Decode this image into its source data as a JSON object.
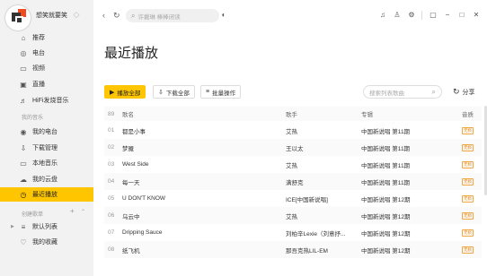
{
  "app": {
    "username": "想笑就要笑"
  },
  "sidebar": {
    "top_items": [
      {
        "label": "推荐",
        "icon": "home-icon"
      },
      {
        "label": "电台",
        "icon": "radio-icon"
      },
      {
        "label": "视频",
        "icon": "video-icon"
      },
      {
        "label": "直播",
        "icon": "live-icon"
      },
      {
        "label": "HiFi发烧音乐",
        "icon": "hifi-icon"
      }
    ],
    "my_music_label": "我的音乐",
    "my_music_items": [
      {
        "label": "我的电台",
        "icon": "my-radio-icon"
      },
      {
        "label": "下载管理",
        "icon": "download-icon"
      },
      {
        "label": "本地音乐",
        "icon": "local-music-icon"
      },
      {
        "label": "我的云盘",
        "icon": "cloud-icon"
      },
      {
        "label": "最近播放",
        "icon": "clock-icon",
        "active": true
      }
    ],
    "created_label": "创建歌单",
    "created_tools": "+",
    "created_items": [
      {
        "label": "默认列表",
        "icon": "playlist-icon"
      },
      {
        "label": "我的收藏",
        "icon": "heart-icon"
      }
    ]
  },
  "topbar": {
    "search_placeholder": "许戴琳 棒棒闭读"
  },
  "page": {
    "title": "最近播放"
  },
  "toolbar": {
    "play_all": "播放全部",
    "download_all": "下载全部",
    "batch": "批量操作",
    "search_placeholder": "搜索列表歌曲",
    "share": "分享"
  },
  "table": {
    "count": "89",
    "headers": {
      "name": "歌名",
      "artist": "歌手",
      "album": "专辑",
      "quality": "音质"
    },
    "rows": [
      {
        "idx": "01",
        "name": "都是小事",
        "artist": "艾热",
        "album": "中国新说唱 第11期",
        "quality": "无损"
      },
      {
        "idx": "02",
        "name": "梦魇",
        "artist": "王以太",
        "album": "中国新说唱 第11期",
        "quality": "无损"
      },
      {
        "idx": "03",
        "name": "West Side",
        "artist": "艾热",
        "album": "中国新说唱 第11期",
        "quality": "无损"
      },
      {
        "idx": "04",
        "name": "每一天",
        "artist": "满舒克",
        "album": "中国新说唱 第11期",
        "quality": "无损"
      },
      {
        "idx": "05",
        "name": "U DON'T KNOW",
        "artist": "ICE[中国新说唱]",
        "album": "中国新说唱 第12期",
        "quality": "无损"
      },
      {
        "idx": "06",
        "name": "乌云中",
        "artist": "艾热",
        "album": "中国新说唱 第12期",
        "quality": "无损"
      },
      {
        "idx": "07",
        "name": "Dripping Sauce",
        "artist": "刘柏辛Lexie（刘意抒...",
        "album": "中国新说唱 第12期",
        "quality": "无损"
      },
      {
        "idx": "08",
        "name": "纸飞机",
        "artist": "那吾克热LIL-EM",
        "album": "中国新说唱 第12期",
        "quality": "无损"
      }
    ]
  }
}
